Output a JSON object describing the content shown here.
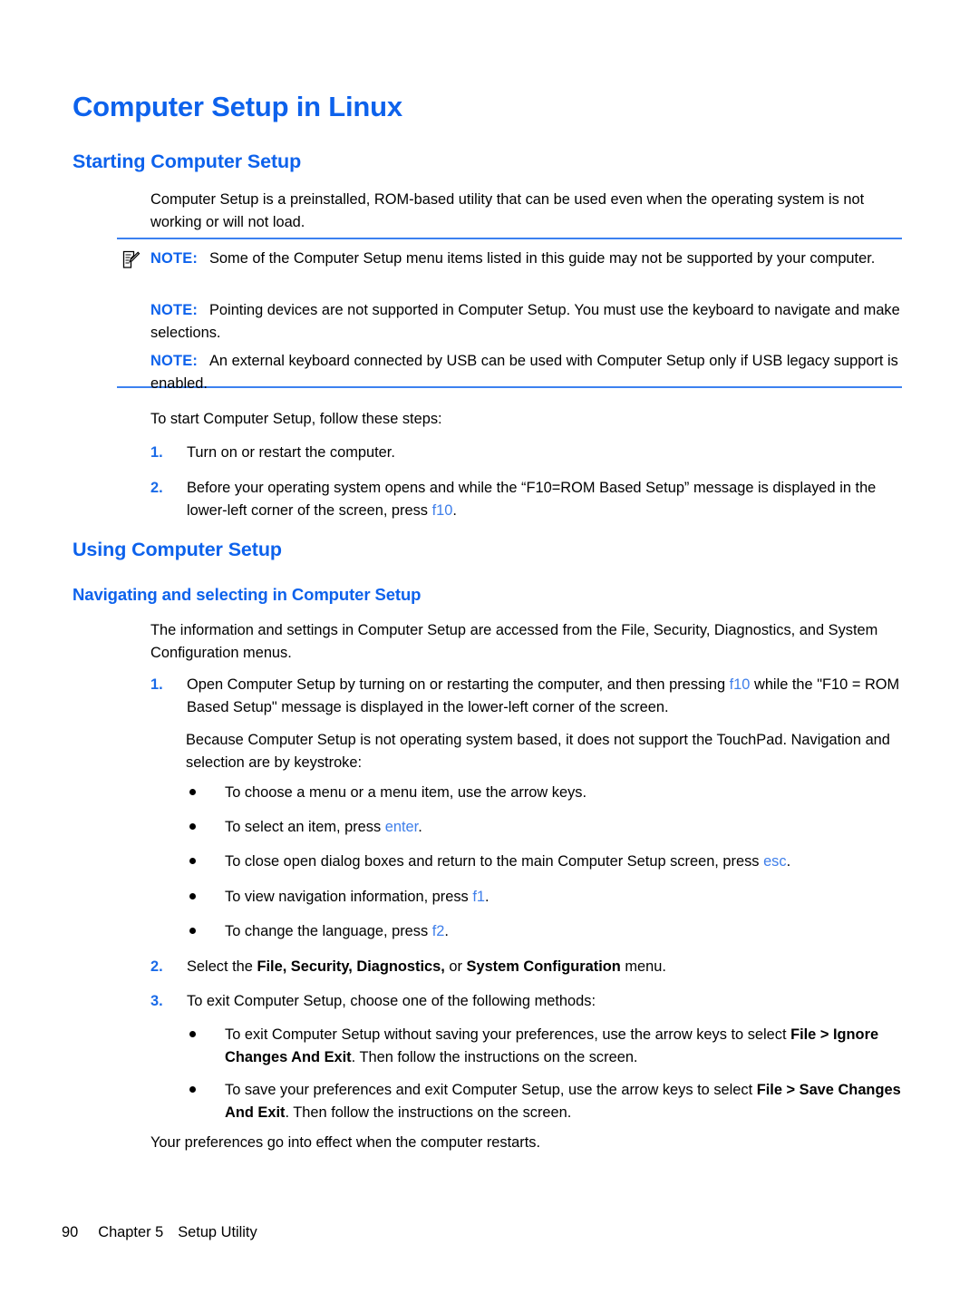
{
  "page": {
    "title": "Computer Setup in Linux",
    "heading_starting": "Starting Computer Setup",
    "heading_using": "Using Computer Setup",
    "heading_navigating": "Navigating and selecting in Computer Setup",
    "colors": {
      "heading_blue": "#0d62ec",
      "key_blue": "#3f7fea",
      "rule_blue": "#3c81f0",
      "number_blue": "#1a6be8",
      "text_black": "#000000",
      "background": "#ffffff"
    }
  },
  "intro": {
    "paragraph": "Computer Setup is a preinstalled, ROM-based utility that can be used even when the operating system is not working or will not load."
  },
  "notes": {
    "label": "NOTE:",
    "icon": "note-pencil-icon",
    "items": [
      {
        "label": "NOTE:",
        "text": "Some of the Computer Setup menu items listed in this guide may not be supported by your computer.",
        "has_icon": true
      },
      {
        "label": "NOTE:",
        "text": "Pointing devices are not supported in Computer Setup. You must use the keyboard to navigate and make selections.",
        "has_icon": false
      },
      {
        "label": "NOTE:",
        "text": "An external keyboard connected by USB can be used with Computer Setup only if USB legacy support is enabled.",
        "has_icon": false
      }
    ]
  },
  "starting": {
    "lead_in": "To start Computer Setup, follow these steps:",
    "steps": [
      {
        "number": "1.",
        "text_before": "Turn on or restart the computer.",
        "key": "",
        "text_after": ""
      },
      {
        "number": "2.",
        "text_before": "Before your operating system opens and while the “F10=ROM Based Setup” message is displayed in the lower-left corner of the screen, press ",
        "key": "f10",
        "text_after": "."
      }
    ]
  },
  "navigating": {
    "intro": "The information and settings in Computer Setup are accessed from the File, Security, Diagnostics, and System Configuration menus.",
    "step1": {
      "number": "1.",
      "text_before": "Open Computer Setup by turning on or restarting the computer, and then pressing ",
      "key": "f10",
      "text_after": " while the \"F10 = ROM Based Setup\" message is displayed in the lower-left corner of the screen."
    },
    "because_paragraph": "Because Computer Setup is not operating system based, it does not support the TouchPad. Navigation and selection are by keystroke:",
    "keystroke_bullets": [
      {
        "text_before": "To choose a menu or a menu item, use the arrow keys.",
        "key": "",
        "text_after": ""
      },
      {
        "text_before": "To select an item, press ",
        "key": "enter",
        "text_after": "."
      },
      {
        "text_before": "To close open dialog boxes and return to the main Computer Setup screen, press ",
        "key": "esc",
        "text_after": "."
      },
      {
        "text_before": "To view navigation information, press ",
        "key": "f1",
        "text_after": "."
      },
      {
        "text_before": "To change the language, press ",
        "key": "f2",
        "text_after": "."
      }
    ],
    "step2": {
      "number": "2.",
      "prefix": "Select the ",
      "menus_bold_a": "File, Security, Diagnostics,",
      "mid": " or ",
      "menus_bold_b": "System Configuration",
      "suffix": " menu."
    },
    "step3": {
      "number": "3.",
      "text": "To exit Computer Setup, choose one of the following methods:"
    },
    "exit_bullets": [
      {
        "prefix": "To exit Computer Setup without saving your preferences, use the arrow keys to select ",
        "bold": "File > Ignore Changes And Exit",
        "suffix": ". Then follow the instructions on the screen."
      },
      {
        "prefix": "To save your preferences and exit Computer Setup, use the arrow keys to select ",
        "bold": "File > Save Changes And Exit",
        "suffix": ". Then follow the instructions on the screen."
      }
    ],
    "closing": "Your preferences go into effect when the computer restarts."
  },
  "footer": {
    "page_number": "90",
    "chapter": "Chapter 5",
    "section": "Setup Utility"
  }
}
